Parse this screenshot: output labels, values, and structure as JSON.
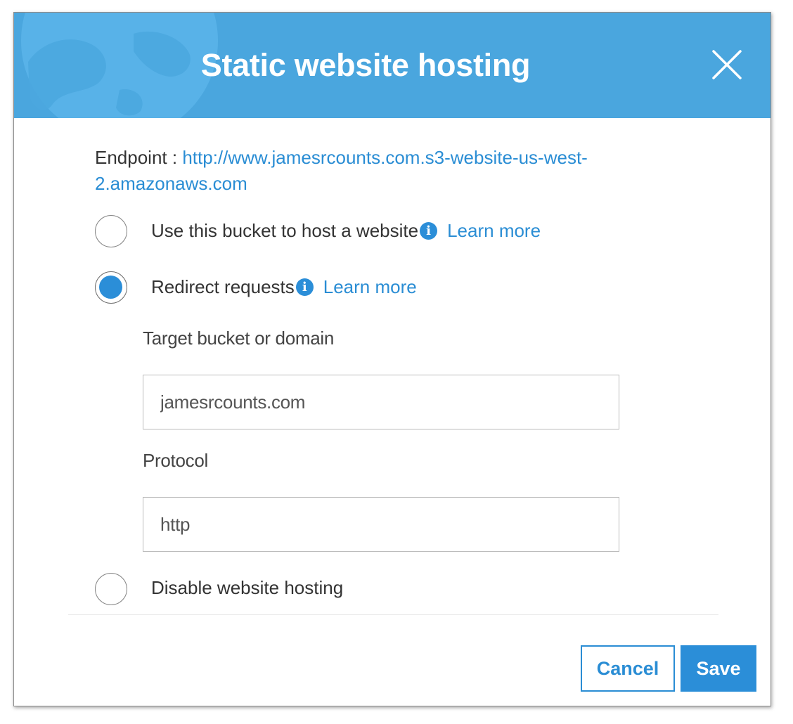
{
  "dialog": {
    "title": "Static website hosting",
    "close_icon": "close-icon"
  },
  "endpoint": {
    "label": "Endpoint :",
    "url": "http://www.jamesrcounts.com.s3-website-us-west-2.amazonaws.com"
  },
  "options": [
    {
      "label": "Use this bucket to host a website",
      "info_icon": "info-icon",
      "learn_more": "Learn more",
      "selected": false
    },
    {
      "label": "Redirect requests",
      "info_icon": "info-icon",
      "learn_more": "Learn more",
      "selected": true
    },
    {
      "label": "Disable website hosting",
      "selected": false
    }
  ],
  "redirect": {
    "target_label": "Target bucket or domain",
    "target_value": "jamesrcounts.com",
    "protocol_label": "Protocol",
    "protocol_value": "http"
  },
  "footer": {
    "cancel_label": "Cancel",
    "save_label": "Save"
  },
  "colors": {
    "header_bg": "#4aa6de",
    "accent": "#2b8ed8",
    "link": "#2a8dd4"
  }
}
